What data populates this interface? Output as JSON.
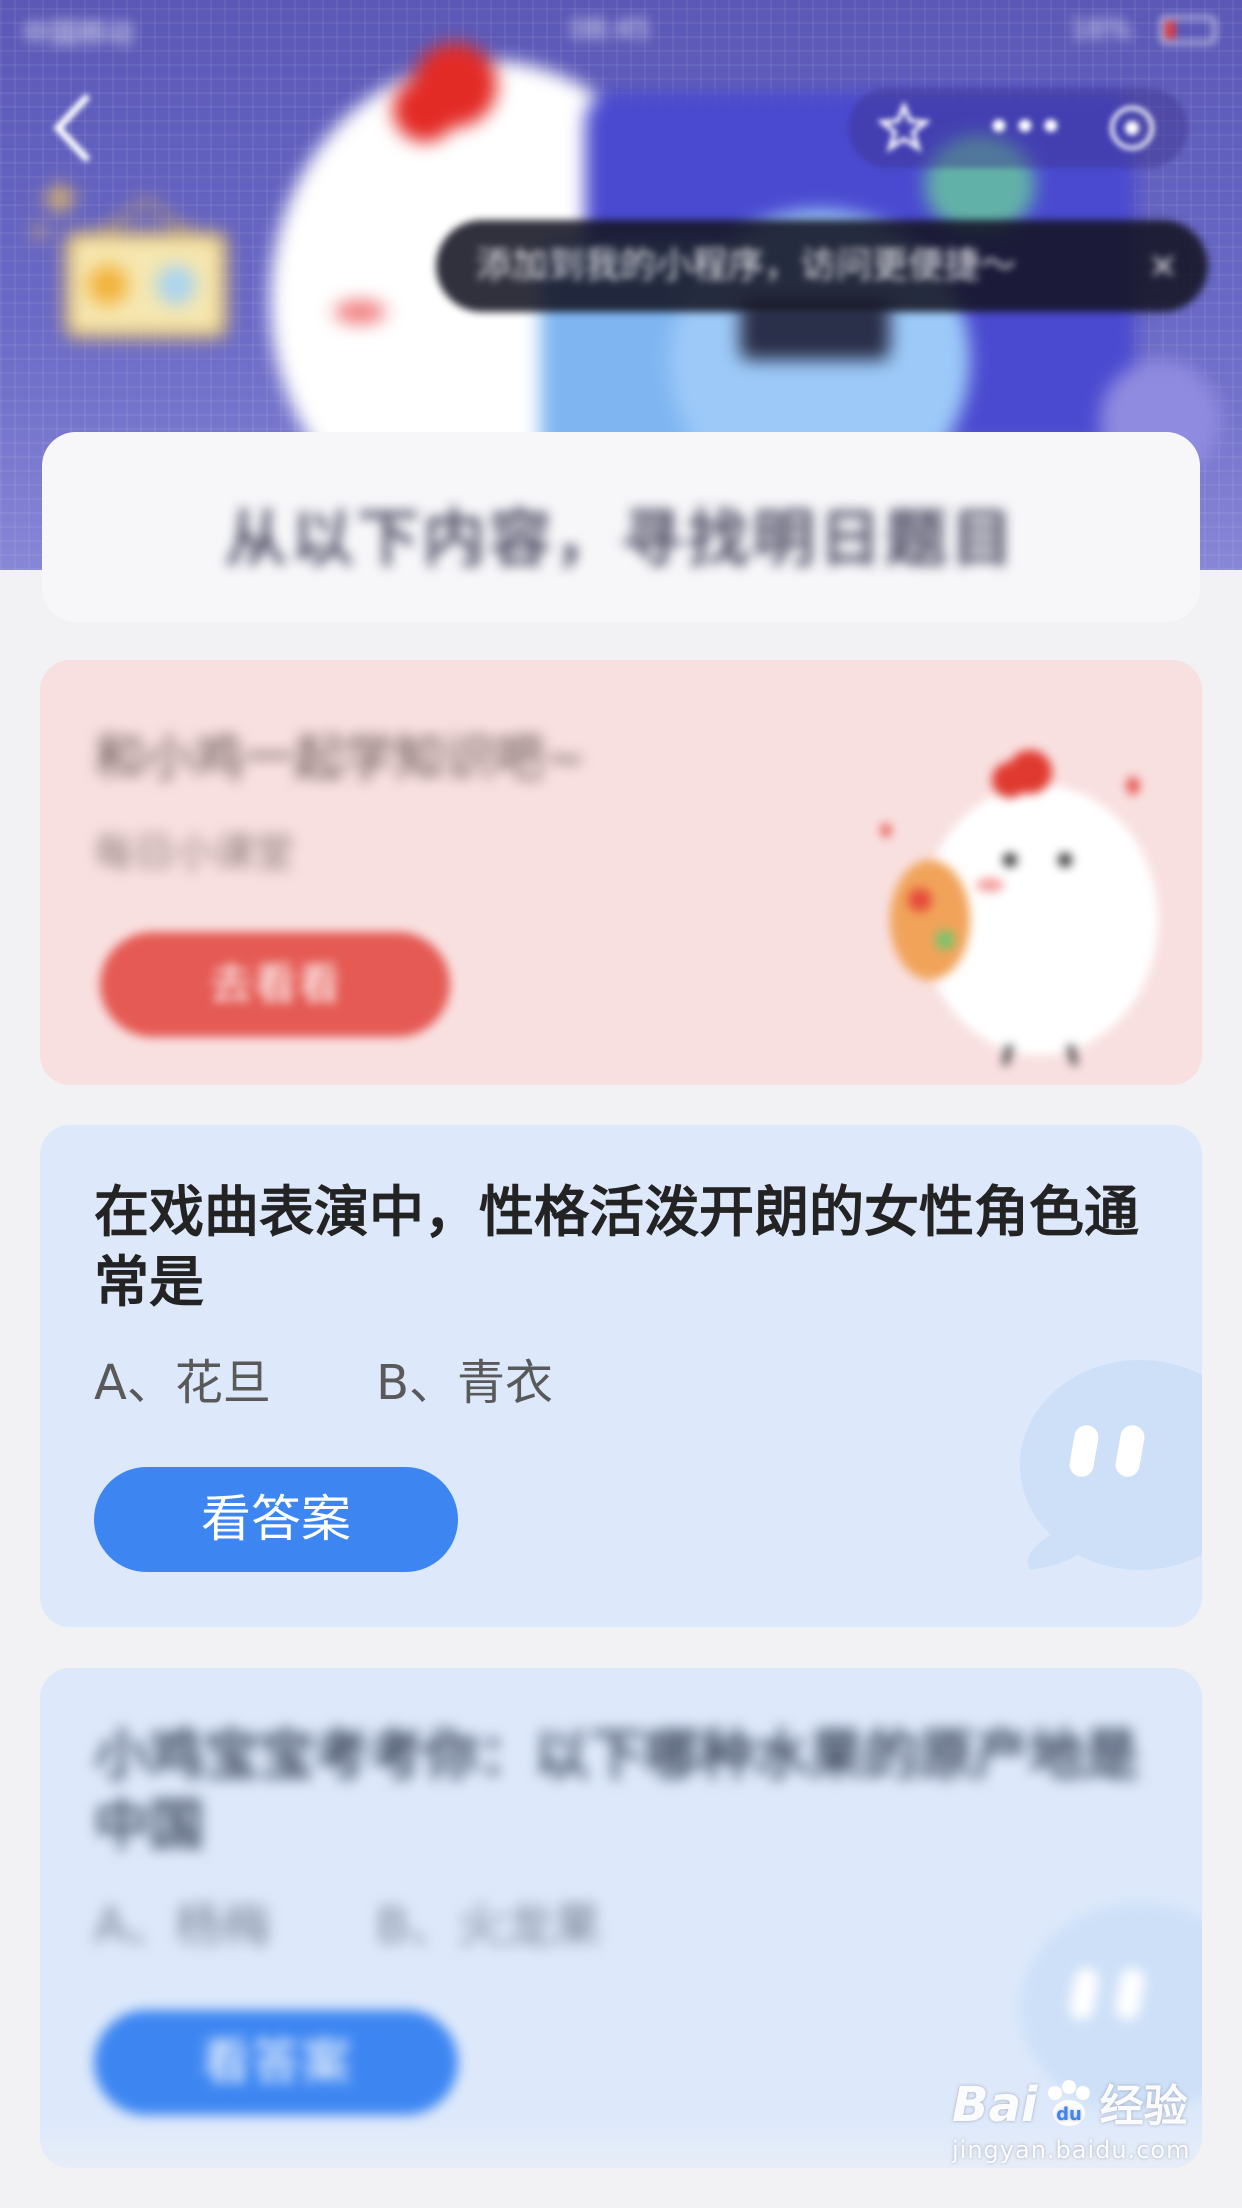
{
  "status_bar": {
    "carrier": "中国移动",
    "time": "08:45",
    "battery": "16%"
  },
  "nav": {
    "back_icon": "chevron-left-icon",
    "star_icon": "star-icon",
    "more_icon": "more-dots-icon",
    "close_icon": "target-close-icon",
    "more_label": "•••"
  },
  "toast": {
    "text": "添加到我的小程序，访问更便捷～",
    "close": "×"
  },
  "subtitle": "从以下内容，寻找明日题目",
  "promo_card": {
    "title": "和小鸡一起学知识吧~",
    "subtitle": "每日小课堂",
    "button": "去看看"
  },
  "question_card": {
    "question": "在戏曲表演中，性格活泼开朗的女性角色通常是",
    "option_a": "A、花旦",
    "option_b": "B、青衣",
    "button": "看答案"
  },
  "question_card_2": {
    "question": "小鸡宝宝考考你：以下哪种水果的原产地是中国",
    "option_a": "A、杨梅",
    "option_b": "B、火龙果",
    "button": "看答案"
  },
  "watermark": {
    "brand": "Bai",
    "brand_suffix": "经验",
    "url": "jingyan.baidu.com"
  },
  "colors": {
    "header": "#5b58b6",
    "promo_bg": "#f9e0e0",
    "promo_button": "#e55a54",
    "question_bg": "#dde9fb",
    "answer_button": "#3d86f2"
  }
}
